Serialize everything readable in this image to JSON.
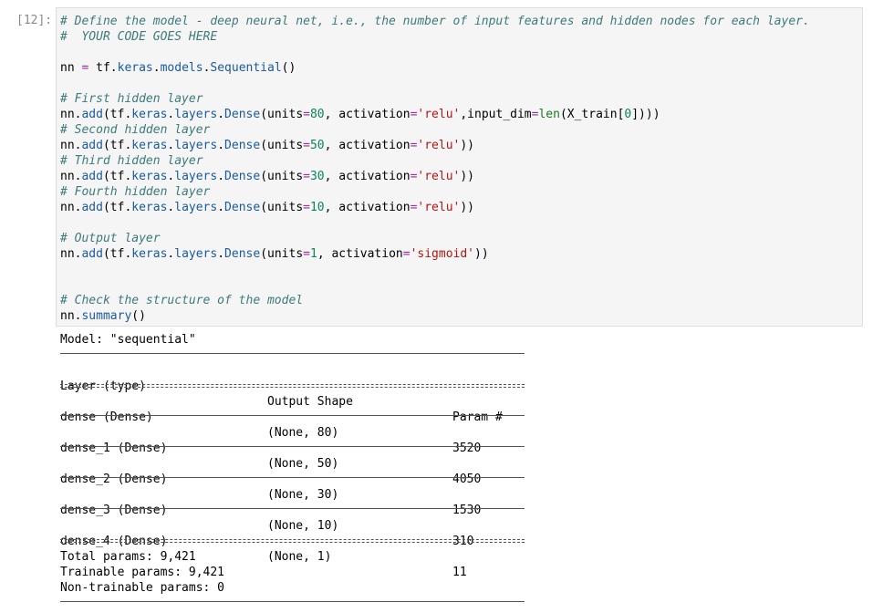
{
  "prompt": "[12]:",
  "code": {
    "l1": "# Define the model - deep neural net, i.e., the number of input features and hidden nodes for each layer.",
    "l2": "#  YOUR CODE GOES HERE",
    "l4a": "nn ",
    "l4b": "=",
    "l4c": " tf",
    "l4d": ".keras.models.Sequential",
    "l4e": "()",
    "c_first": "# First hidden layer",
    "c_second": "# Second hidden layer",
    "c_third": "# Third hidden layer",
    "c_fourth": "# Fourth hidden layer",
    "c_output": "# Output layer",
    "c_check": "# Check the structure of the model",
    "units1": "80",
    "units2": "50",
    "units3": "30",
    "units4": "10",
    "units5": "1",
    "relu": "'relu'",
    "sigmoid": "'sigmoid'",
    "input_dim_tail": "input_dim",
    "len": "len",
    "xtrain": "(X_train[",
    "zero": "0",
    "close": "])))"
  },
  "output": {
    "model_line": "Model: \"sequential\"",
    "headers": {
      "layer": "Layer (type)",
      "shape": "Output Shape",
      "param": "Param #"
    },
    "rows": [
      {
        "layer": "dense (Dense)",
        "shape": "(None, 80)",
        "param": "3520"
      },
      {
        "layer": "dense_1 (Dense)",
        "shape": "(None, 50)",
        "param": "4050"
      },
      {
        "layer": "dense_2 (Dense)",
        "shape": "(None, 30)",
        "param": "1530"
      },
      {
        "layer": "dense_3 (Dense)",
        "shape": "(None, 10)",
        "param": "310"
      },
      {
        "layer": "dense_4 (Dense)",
        "shape": "(None, 1)",
        "param": "11"
      }
    ],
    "total": "Total params: 9,421",
    "trainable": "Trainable params: 9,421",
    "non_trainable": "Non-trainable params: 0"
  }
}
